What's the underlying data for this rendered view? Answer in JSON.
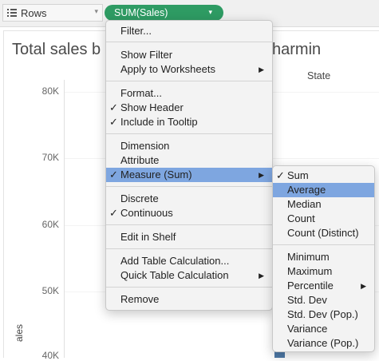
{
  "shelf": {
    "rows_label": "Rows",
    "pill_label": "SUM(Sales)"
  },
  "worksheet": {
    "title_left": "Total sales b",
    "title_right": "harmin",
    "column_header": "State",
    "axis_title": "ales",
    "axis_ticks": [
      "80K",
      "70K",
      "60K",
      "50K",
      "40K"
    ]
  },
  "context_menu": {
    "items": [
      {
        "label": "Filter...",
        "checked": false,
        "submenu": false
      },
      {
        "label": "Show Filter",
        "checked": false,
        "submenu": false
      },
      {
        "label": "Apply to Worksheets",
        "checked": false,
        "submenu": true
      },
      {
        "label": "Format...",
        "checked": false,
        "submenu": false
      },
      {
        "label": "Show Header",
        "checked": true,
        "submenu": false
      },
      {
        "label": "Include in Tooltip",
        "checked": true,
        "submenu": false
      },
      {
        "label": "Dimension",
        "checked": false,
        "submenu": false
      },
      {
        "label": "Attribute",
        "checked": false,
        "submenu": false
      },
      {
        "label": "Measure (Sum)",
        "checked": true,
        "submenu": true,
        "highlighted": true
      },
      {
        "label": "Discrete",
        "checked": false,
        "submenu": false
      },
      {
        "label": "Continuous",
        "checked": true,
        "submenu": false
      },
      {
        "label": "Edit in Shelf",
        "checked": false,
        "submenu": false
      },
      {
        "label": "Add Table Calculation...",
        "checked": false,
        "submenu": false
      },
      {
        "label": "Quick Table Calculation",
        "checked": false,
        "submenu": true
      },
      {
        "label": "Remove",
        "checked": false,
        "submenu": false
      }
    ]
  },
  "aggregation_menu": {
    "items": [
      {
        "label": "Sum",
        "checked": true,
        "submenu": false
      },
      {
        "label": "Average",
        "checked": false,
        "submenu": false,
        "highlighted": true
      },
      {
        "label": "Median",
        "checked": false,
        "submenu": false
      },
      {
        "label": "Count",
        "checked": false,
        "submenu": false
      },
      {
        "label": "Count (Distinct)",
        "checked": false,
        "submenu": false
      },
      {
        "label": "Minimum",
        "checked": false,
        "submenu": false
      },
      {
        "label": "Maximum",
        "checked": false,
        "submenu": false
      },
      {
        "label": "Percentile",
        "checked": false,
        "submenu": true
      },
      {
        "label": "Std. Dev",
        "checked": false,
        "submenu": false
      },
      {
        "label": "Std. Dev (Pop.)",
        "checked": false,
        "submenu": false
      },
      {
        "label": "Variance",
        "checked": false,
        "submenu": false
      },
      {
        "label": "Variance (Pop.)",
        "checked": false,
        "submenu": false
      }
    ]
  },
  "glyphs": {
    "check": "✓",
    "submenu_arrow": "▶",
    "chevron": "▾"
  },
  "colors": {
    "pill": "#2e9b63",
    "menu_highlight": "#7ea6e0",
    "bar": "#4e79a7"
  }
}
